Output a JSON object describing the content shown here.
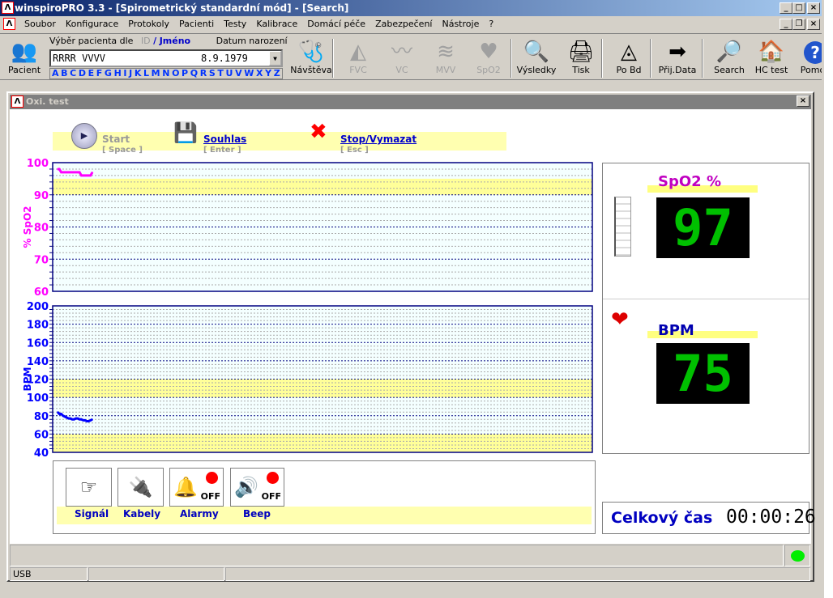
{
  "window": {
    "title": "winspiroPRO 3.3 - [Spirometrický standardní mód] - [Search]"
  },
  "menu": [
    "Soubor",
    "Konfigurace",
    "Protokoly",
    "Pacienti",
    "Testy",
    "Kalibrace",
    "Domácí péče",
    "Zabezpečení",
    "Nástroje",
    "?"
  ],
  "toolbar": {
    "patient_label": "Pacient",
    "select_label": "Výběr pacienta dle",
    "id_label": "ID",
    "slash": "/",
    "name_label": "Jméno",
    "dob_label": "Datum narození",
    "patient_name": "RRRR VVVV",
    "patient_dob": "8.9.1979",
    "alphabet": [
      "A",
      "B",
      "C",
      "D",
      "E",
      "F",
      "G",
      "H",
      "I",
      "J",
      "K",
      "L",
      "M",
      "N",
      "O",
      "P",
      "Q",
      "R",
      "S",
      "T",
      "U",
      "V",
      "W",
      "X",
      "Y",
      "Z"
    ],
    "buttons": [
      {
        "label": "Návštěva",
        "icon": "visit-icon",
        "enabled": true
      },
      {
        "label": "FVC",
        "icon": "fvc-icon",
        "enabled": false
      },
      {
        "label": "VC",
        "icon": "vc-icon",
        "enabled": false
      },
      {
        "label": "MVV",
        "icon": "mvv-icon",
        "enabled": false
      },
      {
        "label": "SpO2",
        "icon": "heart-icon",
        "enabled": false
      },
      {
        "label": "Výsledky",
        "icon": "results-icon",
        "enabled": true
      },
      {
        "label": "Tisk",
        "icon": "printer-icon",
        "enabled": true
      },
      {
        "label": "Po Bd",
        "icon": "post-bd-icon",
        "enabled": true
      },
      {
        "label": "Přij.Data",
        "icon": "receive-data-icon",
        "enabled": true
      },
      {
        "label": "Search",
        "icon": "search-icon",
        "enabled": true
      },
      {
        "label": "HC test",
        "icon": "home-care-icon",
        "enabled": true
      },
      {
        "label": "Pomoc",
        "icon": "help-icon",
        "enabled": true
      }
    ]
  },
  "child": {
    "title": "Oxi. test",
    "actions": {
      "start": {
        "label": "Start",
        "key": "[ Space ]"
      },
      "accept": {
        "label": "Souhlas",
        "key": "[ Enter ]"
      },
      "stop": {
        "label": "Stop/Vymazat",
        "key": "[ Esc ]"
      }
    },
    "spo2_panel": {
      "label": "SpO2 %",
      "value": "97"
    },
    "bpm_panel": {
      "label": "BPM",
      "value": "75"
    },
    "total_time": {
      "label": "Celkový čas",
      "value": "00:00:26"
    },
    "status_buttons": [
      {
        "label": "Signál",
        "icon": "finger-signal-icon"
      },
      {
        "label": "Kabely",
        "icon": "cable-plug-icon"
      },
      {
        "label": "Alarmy",
        "icon": "bell-icon",
        "state": "OFF"
      },
      {
        "label": "Beep",
        "icon": "speaker-icon",
        "state": "OFF"
      }
    ],
    "statusbar": {
      "port": "USB",
      "connection_color": "#00ee00"
    }
  },
  "chart_data": [
    {
      "type": "line",
      "ylabel": "% SpO2",
      "ylim": [
        60,
        100
      ],
      "yticks": [
        60,
        70,
        80,
        90,
        100
      ],
      "band": {
        "from": 90,
        "to": 95,
        "color": "#ffff99"
      },
      "color": "#ff00ff",
      "xlim": [
        0,
        100
      ],
      "x": [
        0,
        1,
        2,
        3,
        4,
        5,
        6,
        7,
        8,
        9,
        10,
        11,
        12,
        13,
        14,
        15,
        16,
        17,
        18,
        19
      ],
      "values": [
        98,
        98,
        97,
        97,
        97,
        97,
        97,
        97,
        97,
        97,
        97,
        97,
        97,
        96,
        96,
        96,
        96,
        96,
        96,
        97
      ]
    },
    {
      "type": "line",
      "ylabel": "BPM",
      "ylim": [
        40,
        200
      ],
      "yticks": [
        40,
        60,
        80,
        100,
        120,
        140,
        160,
        180,
        200
      ],
      "bands": [
        {
          "from": 100,
          "to": 120,
          "color": "#ffff99"
        },
        {
          "from": 40,
          "to": 60,
          "color": "#ffff99"
        }
      ],
      "color": "#0000ff",
      "xlim": [
        0,
        100
      ],
      "x": [
        0,
        1,
        2,
        3,
        4,
        5,
        6,
        7,
        8,
        9,
        10,
        11,
        12,
        13,
        14,
        15,
        16,
        17,
        18,
        19
      ],
      "values": [
        84,
        82,
        82,
        80,
        79,
        78,
        77,
        77,
        76,
        76,
        77,
        77,
        76,
        76,
        75,
        75,
        74,
        74,
        75,
        76
      ]
    }
  ]
}
